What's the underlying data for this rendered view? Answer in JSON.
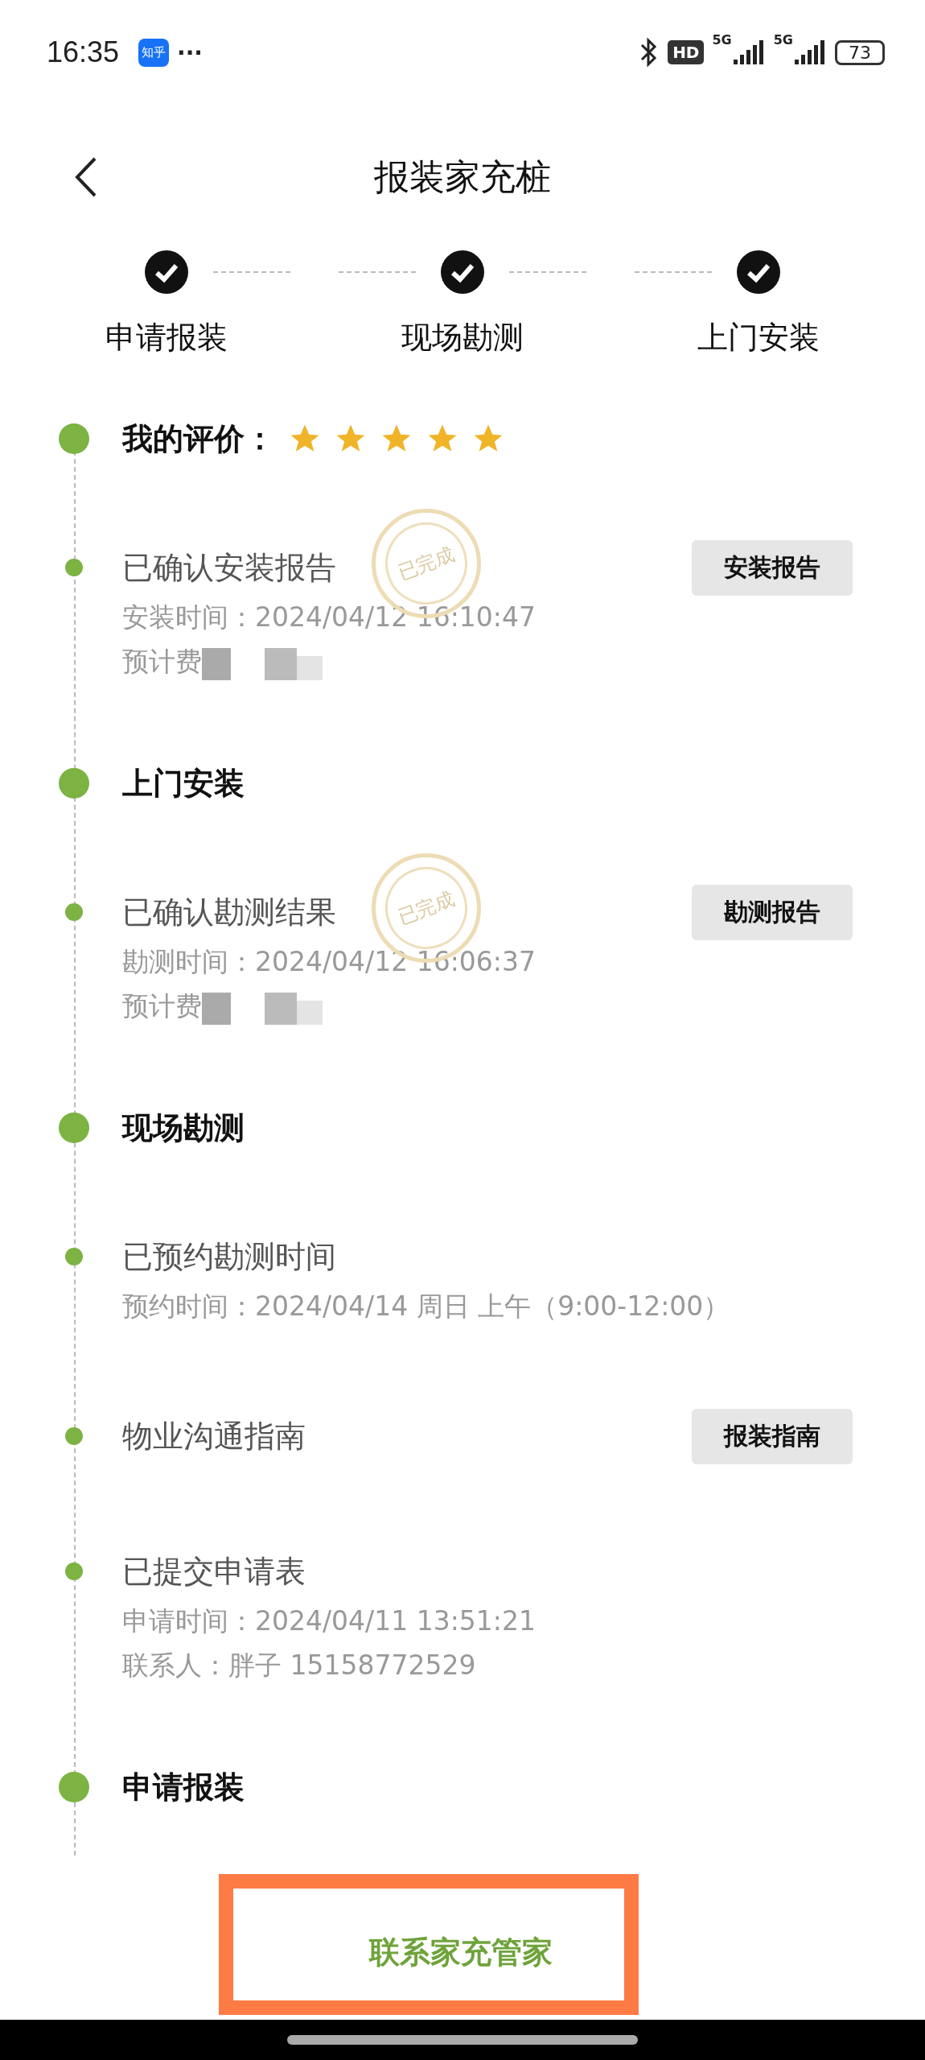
{
  "status_bar": {
    "time": "16:35",
    "app_badge": "知乎",
    "more": "···",
    "hd_badge": "HD",
    "network_1": "5G",
    "network_2": "5G",
    "battery": "73"
  },
  "header": {
    "title": "报装家充桩"
  },
  "steps": [
    {
      "label": "申请报装",
      "done": true
    },
    {
      "label": "现场勘测",
      "done": true
    },
    {
      "label": "上门安装",
      "done": true
    }
  ],
  "timeline": [
    {
      "kind": "rating",
      "label": "我的评价：",
      "stars": 5
    },
    {
      "kind": "event",
      "title": "已确认安装报告",
      "stamp": "已完成",
      "lines": [
        {
          "text": "安装时间：2024/04/12 16:10:47",
          "redacted": false
        },
        {
          "text": "预计费",
          "redacted": true
        }
      ],
      "button": "安装报告"
    },
    {
      "kind": "section",
      "title": "上门安装"
    },
    {
      "kind": "event",
      "title": "已确认勘测结果",
      "stamp": "已完成",
      "lines": [
        {
          "text": "勘测时间：2024/04/12 16:06:37",
          "redacted": false
        },
        {
          "text": "预计费",
          "redacted": true
        }
      ],
      "button": "勘测报告"
    },
    {
      "kind": "section",
      "title": "现场勘测"
    },
    {
      "kind": "event",
      "title": "已预约勘测时间",
      "lines": [
        {
          "text": "预约时间：2024/04/14 周日 上午（9:00-12:00）",
          "redacted": false
        }
      ]
    },
    {
      "kind": "event",
      "title": "物业沟通指南",
      "button": "报装指南"
    },
    {
      "kind": "event",
      "title": "已提交申请表",
      "lines": [
        {
          "text": "申请时间：2024/04/11 13:51:21",
          "redacted": false
        },
        {
          "text": "联系人：胖子 15158772529",
          "redacted": false
        }
      ]
    },
    {
      "kind": "section",
      "title": "申请报装"
    }
  ],
  "footer": {
    "button": "联系家充管家",
    "highlighted": true
  }
}
